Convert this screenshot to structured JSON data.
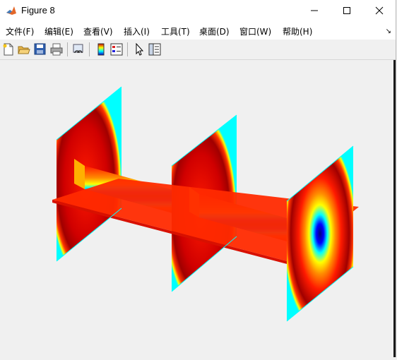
{
  "window": {
    "title": "Figure 8"
  },
  "menu": {
    "items": [
      {
        "label": "文件(F)"
      },
      {
        "label": "编辑(E)"
      },
      {
        "label": "查看(V)"
      },
      {
        "label": "插入(I)"
      },
      {
        "label": "工具(T)"
      },
      {
        "label": "桌面(D)"
      },
      {
        "label": "窗口(W)"
      },
      {
        "label": "帮助(H)"
      }
    ]
  },
  "toolbar": {
    "icons": [
      "new-figure-icon",
      "open-file-icon",
      "save-icon",
      "print-icon",
      "link-plot-icon",
      "insert-colorbar-icon",
      "insert-legend-icon",
      "edit-plot-icon",
      "property-inspector-icon"
    ]
  },
  "figure": {
    "type": "slice-volume",
    "colormap": "jet",
    "colors": {
      "dark_red": "#8b0000",
      "red": "#ff1a00",
      "orange": "#ff8c00",
      "yellow": "#ffff00",
      "cyan": "#00ffff",
      "blue": "#0000ff",
      "navy": "#00007f"
    }
  }
}
